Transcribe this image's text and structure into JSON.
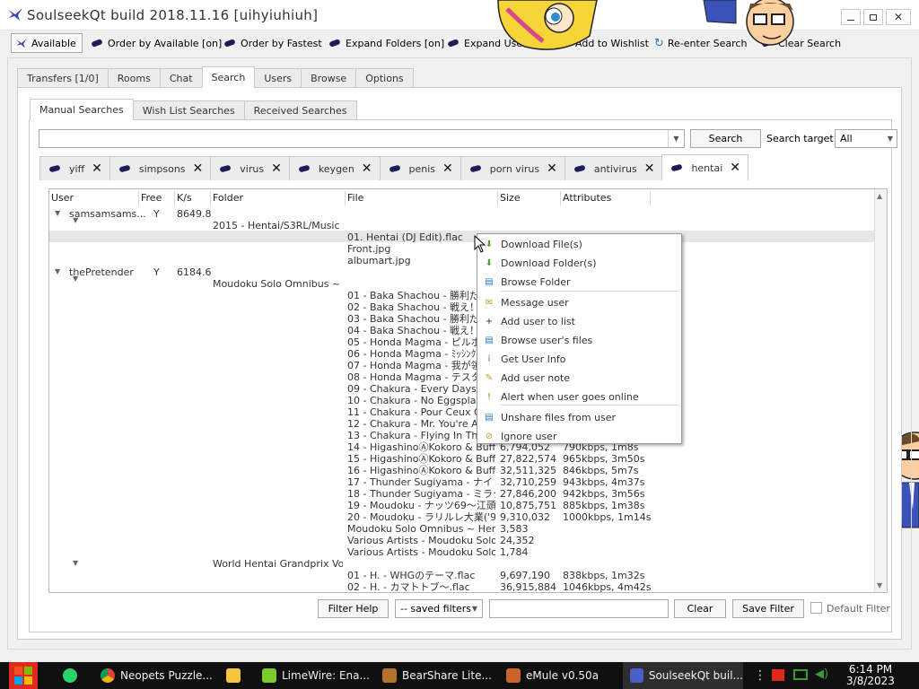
{
  "window": {
    "title": "SoulseekQt build 2018.11.16 [uihyiuhiuh]"
  },
  "toolbar": {
    "available": "Available",
    "order_available": "Order by Available [on]",
    "order_fastest": "Order by Fastest",
    "expand_folders": "Expand Folders [on]",
    "expand_users": "Expand Users",
    "add_wishlist": "Add to Wishlist",
    "reenter_search": "Re-enter Search",
    "clear_search": "Clear Search"
  },
  "main_tabs": [
    "Transfers [1/0]",
    "Rooms",
    "Chat",
    "Search",
    "Users",
    "Browse",
    "Options"
  ],
  "search_tabs": [
    "Manual Searches",
    "Wish List Searches",
    "Received Searches"
  ],
  "search": {
    "input_value": "",
    "button": "Search",
    "target_label": "Search target:",
    "target_value": "All"
  },
  "query_tabs": [
    "yiff",
    "simpsons",
    "virus",
    "keygen",
    "penis",
    "porn virus",
    "antivirus",
    "hentai"
  ],
  "columns": [
    "User",
    "Free",
    "K/s",
    "Folder",
    "File",
    "Size",
    "Attributes"
  ],
  "results": {
    "user1": {
      "name": "samsamsams...",
      "free": "Y",
      "speed": "8649.8"
    },
    "user1_folder": "2015 - Hentai/S3RL/Music",
    "user1_files": [
      {
        "file": "01. Hentai (DJ Edit).flac",
        "size": "",
        "attr": ""
      },
      {
        "file": "Front.jpg",
        "size": "",
        "attr": ""
      },
      {
        "file": "albumart.jpg",
        "size": "",
        "attr": ""
      }
    ],
    "user2": {
      "name": "thePretender",
      "free": "Y",
      "speed": "6184.6"
    },
    "user2_folder": "Moudoku Solo Omnibus ~ H...",
    "user2_files": [
      {
        "file": "01 - Baka Shachou - 勝利だ！",
        "size": "",
        "attr": ""
      },
      {
        "file": "02 - Baka Shachou - 戦え！！",
        "size": "",
        "attr": ""
      },
      {
        "file": "03 - Baka Shachou - 勝利だ！",
        "size": "",
        "attr": ""
      },
      {
        "file": "04 - Baka Shachou - 戦え！！",
        "size": "",
        "attr": ""
      },
      {
        "file": "05 - Honda Magma - ピルボケ.fl",
        "size": "",
        "attr": ""
      },
      {
        "file": "06 - Honda Magma - ﾐｯｼﾝｸﾞ･",
        "size": "",
        "attr": ""
      },
      {
        "file": "07 - Honda Magma - 我が領土",
        "size": "",
        "attr": ""
      },
      {
        "file": "08 - Honda Magma - テスタ～.fl",
        "size": "",
        "attr": ""
      },
      {
        "file": "09 - Chakura - Every Days A N",
        "size": "",
        "attr": ""
      },
      {
        "file": "10 - Chakura - No Eggsplanati",
        "size": "",
        "attr": ""
      },
      {
        "file": "11 - Chakura - Pour Ceux Qui",
        "size": "",
        "attr": ""
      },
      {
        "file": "12 - Chakura - Mr. You're A Be",
        "size": "",
        "attr": ""
      },
      {
        "file": "13 - Chakura - Flying In The F",
        "size": "",
        "attr": ""
      },
      {
        "file": "14 - HigashinoⒶKokoro & Buffal...",
        "size": "6,794,052",
        "attr": "790kbps, 1m8s"
      },
      {
        "file": "15 - HigashinoⒶKokoro & Buffal...",
        "size": "27,822,574",
        "attr": "965kbps, 3m50s"
      },
      {
        "file": "16 - HigashinoⒶKokoro & Buffal...",
        "size": "32,511,325",
        "attr": "846kbps, 5m7s"
      },
      {
        "file": "17 - Thunder Sugiyama - ナイトコ...",
        "size": "32,710,259",
        "attr": "943kbps, 4m37s"
      },
      {
        "file": "18 - Thunder Sugiyama - ミラクル ...",
        "size": "27,846,200",
        "attr": "942kbps, 3m56s"
      },
      {
        "file": "19 - Moudoku - ナッツ69～江頭豊...",
        "size": "10,875,751",
        "attr": "885kbps, 1m38s"
      },
      {
        "file": "20 - Moudoku - ラリルレ大業('93...",
        "size": "9,310,032",
        "attr": "1000kbps, 1m14s"
      },
      {
        "file": "Moudoku Solo Omnibus ~ Henta...",
        "size": "3,583",
        "attr": ""
      },
      {
        "file": "Various Artists - Moudoku Solo ...",
        "size": "24,352",
        "attr": ""
      },
      {
        "file": "Various Artists - Moudoku Solo ...",
        "size": "1,784",
        "attr": ""
      }
    ],
    "user2_folder2": "World Hentai Grandprix Vol....",
    "user2_files2": [
      {
        "file": "01 - H. - WHGのテーマ.flac",
        "size": "9,697,190",
        "attr": "838kbps, 1m32s"
      },
      {
        "file": "02 - H. - カマトトブ～.flac",
        "size": "36,915,884",
        "attr": "1046kbps, 4m42s"
      }
    ]
  },
  "context_menu": [
    "Download File(s)",
    "Download Folder(s)",
    "Browse Folder",
    "Message user",
    "Add user to list",
    "Browse user's files",
    "Get User Info",
    "Add user note",
    "Alert when user goes online",
    "Unshare files from user",
    "Ignore user"
  ],
  "filters": {
    "help": "Filter Help",
    "saved": "-- saved filters",
    "input_value": "",
    "clear": "Clear",
    "save": "Save Filter",
    "default": "Default Filter"
  },
  "taskbar": {
    "apps": [
      "Neopets Puzzle...",
      "",
      "LimeWire: Ena...",
      "BearShare Lite...",
      "eMule v0.50a",
      "SoulseekQt buil..."
    ],
    "time": "6:14 PM",
    "date": "3/8/2023"
  },
  "colors": {
    "accent": "#1c1c5a",
    "taskbar": "#101010",
    "start": "#e0281c"
  }
}
